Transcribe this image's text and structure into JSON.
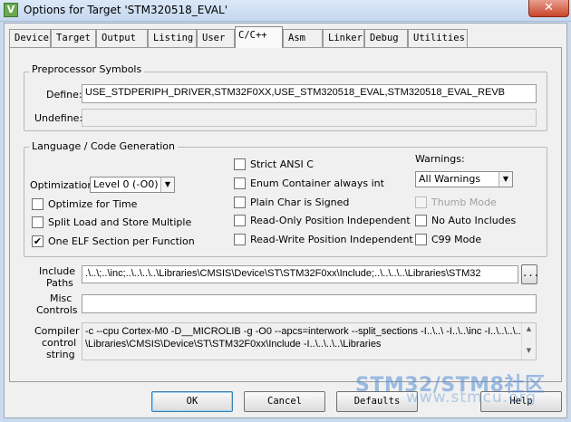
{
  "window": {
    "title": "Options for Target 'STM320518_EVAL'",
    "close_glyph": "✕"
  },
  "tabs": [
    "Device",
    "Target",
    "Output",
    "Listing",
    "User",
    "C/C++",
    "Asm",
    "Linker",
    "Debug",
    "Utilities"
  ],
  "active_tab": "C/C++",
  "preprocessor": {
    "group_title": "Preprocessor Symbols",
    "define_label": "Define:",
    "define_value": "USE_STDPERIPH_DRIVER,STM32F0XX,USE_STM320518_EVAL,STM320518_EVAL_REVB",
    "undefine_label": "Undefine:",
    "undefine_value": ""
  },
  "codegen": {
    "group_title": "Language / Code Generation",
    "optimization_label": "Optimization:",
    "optimization_value": "Level 0 (-O0)",
    "optimize_time": {
      "label": "Optimize for Time",
      "checked": false
    },
    "split_load": {
      "label": "Split Load and Store Multiple",
      "checked": false
    },
    "one_elf": {
      "label": "One ELF Section per Function",
      "checked": true
    },
    "strict_ansi": {
      "label": "Strict ANSI C",
      "checked": false
    },
    "enum_container": {
      "label": "Enum Container always int",
      "checked": false
    },
    "plain_char": {
      "label": "Plain Char is Signed",
      "checked": false
    },
    "ropi": {
      "label": "Read-Only Position Independent",
      "checked": false
    },
    "rwpi": {
      "label": "Read-Write Position Independent",
      "checked": false
    },
    "warnings_label": "Warnings:",
    "warnings_value": "All Warnings",
    "thumb_mode": {
      "label": "Thumb Mode",
      "checked": false,
      "disabled": true
    },
    "no_auto_includes": {
      "label": "No Auto Includes",
      "checked": false
    },
    "c99_mode": {
      "label": "C99 Mode",
      "checked": false
    }
  },
  "paths": {
    "include_label_1": "Include",
    "include_label_2": "Paths",
    "include_value": ".\\..\\;..\\inc;..\\..\\..\\..\\Libraries\\CMSIS\\Device\\ST\\STM32F0xx\\Include;..\\..\\..\\..\\Libraries\\STM32",
    "browse_label": "...",
    "misc_label_1": "Misc",
    "misc_label_2": "Controls",
    "misc_value": "",
    "compiler_label_1": "Compiler",
    "compiler_label_2": "control",
    "compiler_label_3": "string",
    "compiler_line_1": "-c --cpu Cortex-M0 -D__MICROLIB -g -O0 --apcs=interwork --split_sections -I..\\..\\ -I..\\..\\inc -I..\\..\\..\\..",
    "compiler_line_2": "\\Libraries\\CMSIS\\Device\\ST\\STM32F0xx\\Include -I..\\..\\..\\..\\Libraries"
  },
  "buttons": {
    "ok": "OK",
    "cancel": "Cancel",
    "defaults": "Defaults",
    "help": "Help"
  },
  "watermark": {
    "line1": "STM32/STM8社区",
    "line2": "www.stmcu.org"
  }
}
